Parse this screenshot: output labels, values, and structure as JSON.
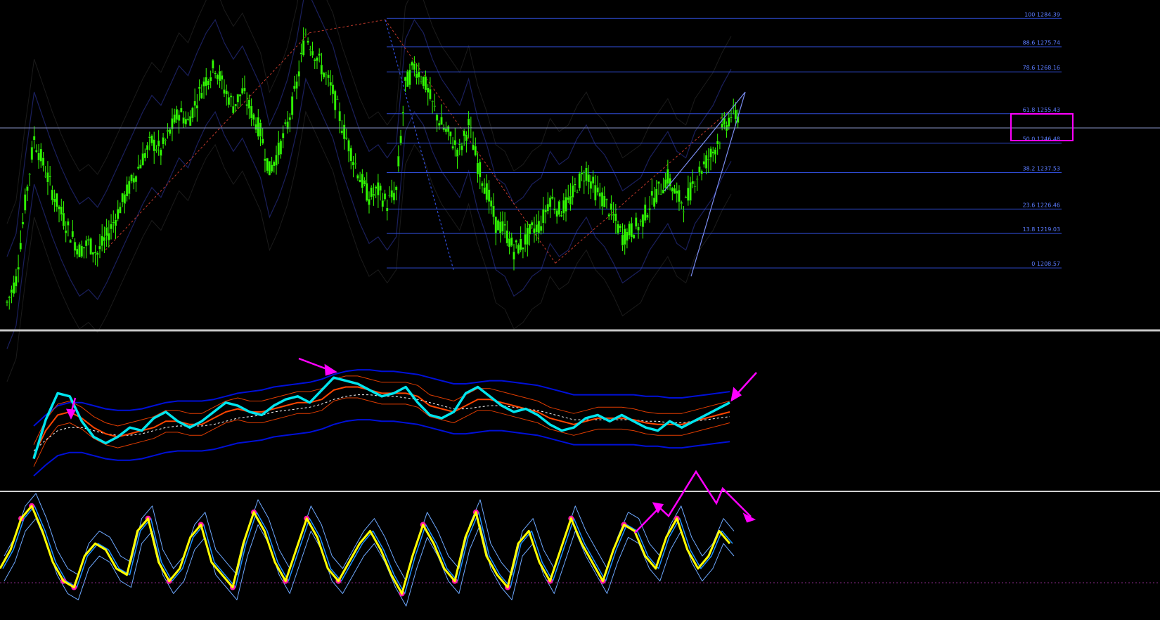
{
  "window": {
    "background": "#000000"
  },
  "colors": {
    "fib_line": "#2f4cd6",
    "fib_text": "#5b7cff",
    "candle": "#33ff00",
    "candle_outline": "#0c4f0c",
    "bands_main": "#1a1f5c",
    "fib_trend": "#c0392b",
    "panel_sep": "#c8c8c8",
    "rsi_main": "#00e5ee",
    "rsi_ma": "#ff4500",
    "rsi_signal": "#ffffff",
    "rsi_band_outer": "#0010d8",
    "rsi_band_inner": "#e03c00",
    "osc_main": "#ffff00",
    "osc_dots": "#ff1aa8",
    "osc_signal": "#1e90ff",
    "osc_band": "#6da8ff",
    "annotation": "#ff00ff"
  },
  "chart_data": [
    {
      "type": "line",
      "panel": "price",
      "series": [
        {
          "values": [
            1198,
            1205,
            1228,
            1248,
            1240,
            1232,
            1225,
            1219,
            1214,
            1216,
            1213,
            1218,
            1224,
            1230,
            1236,
            1242,
            1247,
            1244,
            1250,
            1256,
            1253,
            1260,
            1266,
            1270,
            1263,
            1258,
            1262,
            1256,
            1250,
            1238,
            1244,
            1252,
            1264,
            1280,
            1274,
            1268,
            1262,
            1252,
            1244,
            1236,
            1230,
            1232,
            1228,
            1232,
            1264,
            1270,
            1266,
            1258,
            1252,
            1248,
            1244,
            1252,
            1240,
            1232,
            1222,
            1220,
            1214,
            1216,
            1220,
            1222,
            1230,
            1226,
            1228,
            1234,
            1238,
            1232,
            1229,
            1224,
            1218,
            1220,
            1222,
            1228,
            1232,
            1236,
            1230,
            1228,
            1236,
            1240,
            1244,
            1250,
            1255
          ]
        }
      ],
      "ylim": [
        1190,
        1290
      ],
      "fibonacci_levels": [
        {
          "label": "100 1284.39",
          "value": 1284.39
        },
        {
          "label": "88.6 1275.74",
          "value": 1275.74
        },
        {
          "label": "78.6 1268.16",
          "value": 1268.16
        },
        {
          "label": "61.8 1255.43",
          "value": 1255.43,
          "highlight": true
        },
        {
          "label": "50.0 1246.48",
          "value": 1246.48
        },
        {
          "label": "38.2 1237.53",
          "value": 1237.53
        },
        {
          "label": "23.6 1226.46",
          "value": 1226.46
        },
        {
          "label": "13.8 1219.03",
          "value": 1219.03
        },
        {
          "label": "0 1208.57",
          "value": 1208.57
        }
      ],
      "grid": false
    },
    {
      "type": "line",
      "panel": "rsi",
      "series": [
        {
          "values": [
            20,
            45,
            62,
            60,
            44,
            34,
            30,
            34,
            40,
            38,
            46,
            50,
            44,
            40,
            44,
            50,
            56,
            54,
            50,
            48,
            54,
            58,
            60,
            56,
            64,
            72,
            70,
            68,
            64,
            60,
            62,
            66,
            56,
            48,
            46,
            50,
            62,
            66,
            60,
            54,
            50,
            52,
            48,
            42,
            38,
            40,
            46,
            48,
            44,
            48,
            44,
            40,
            38,
            44,
            40,
            44,
            48,
            52,
            56
          ]
        },
        {
          "values": [
            22,
            38,
            48,
            50,
            46,
            40,
            36,
            34,
            36,
            38,
            40,
            44,
            44,
            42,
            42,
            46,
            50,
            52,
            50,
            50,
            52,
            54,
            56,
            56,
            58,
            64,
            66,
            66,
            64,
            62,
            62,
            62,
            60,
            54,
            52,
            50,
            54,
            58,
            58,
            56,
            54,
            52,
            50,
            46,
            44,
            42,
            44,
            46,
            46,
            46,
            45,
            43,
            42,
            42,
            42,
            44,
            46,
            48,
            50
          ]
        },
        {
          "values": [
            25,
            32,
            38,
            40,
            40,
            38,
            36,
            35,
            35,
            36,
            38,
            40,
            41,
            41,
            41,
            42,
            44,
            46,
            47,
            48,
            50,
            51,
            52,
            53,
            55,
            58,
            60,
            61,
            61,
            60,
            60,
            59,
            58,
            56,
            54,
            52,
            52,
            53,
            54,
            54,
            53,
            52,
            51,
            49,
            47,
            45,
            45,
            45,
            45,
            45,
            45,
            44,
            44,
            43,
            43,
            44,
            45,
            46,
            47
          ]
        }
      ],
      "ylim": [
        0,
        100
      ]
    },
    {
      "type": "line",
      "panel": "oscillator",
      "series": [
        {
          "values": [
            40,
            55,
            80,
            90,
            70,
            45,
            30,
            25,
            50,
            60,
            55,
            40,
            35,
            70,
            80,
            45,
            30,
            40,
            65,
            75,
            45,
            35,
            25,
            60,
            85,
            70,
            45,
            30,
            55,
            80,
            65,
            40,
            30,
            45,
            60,
            70,
            55,
            35,
            20,
            50,
            75,
            60,
            40,
            30,
            65,
            85,
            50,
            35,
            25,
            60,
            70,
            45,
            30,
            55,
            80,
            60,
            45,
            30,
            55,
            75,
            70,
            50,
            40,
            65,
            80,
            55,
            40,
            50,
            70,
            60
          ]
        }
      ],
      "ylim": [
        0,
        100
      ]
    }
  ]
}
